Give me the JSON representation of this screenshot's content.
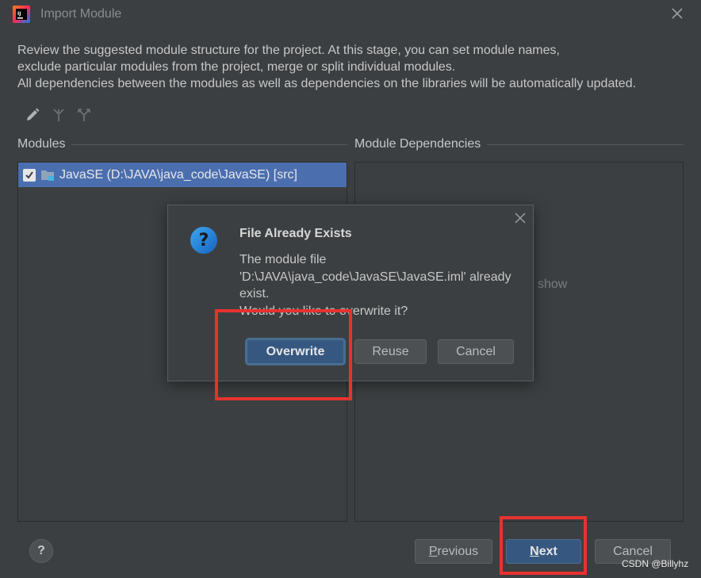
{
  "window": {
    "title": "Import Module",
    "icons": {
      "app": "intellij-idea-icon",
      "close": "close-icon"
    }
  },
  "description": {
    "line1": "Review the suggested module structure for the project. At this stage, you can set module names,",
    "line2": "exclude particular modules from the project, merge or split individual modules.",
    "line3": "All dependencies between the modules as well as dependencies on the libraries will be automatically updated."
  },
  "toolbar": {
    "icons": [
      "edit-icon",
      "merge-icon",
      "split-icon"
    ]
  },
  "modules": {
    "header": "Modules",
    "items": [
      {
        "label": "JavaSE (D:\\JAVA\\java_code\\JavaSE) [src]",
        "checked": true
      }
    ]
  },
  "dependencies": {
    "header": "Module Dependencies",
    "hint": "show"
  },
  "dialog": {
    "title": "File Already Exists",
    "message_line1": "The module file",
    "message_line2": "'D:\\JAVA\\java_code\\JavaSE\\JavaSE.iml' already",
    "message_line3": "exist.",
    "message_line4": "Would you like to overwrite it?",
    "buttons": {
      "overwrite": "Overwrite",
      "reuse": "Reuse",
      "cancel": "Cancel"
    },
    "icon": "question-icon"
  },
  "footer": {
    "help": "?",
    "previous_mnemonic": "P",
    "previous_rest": "revious",
    "next_mnemonic": "N",
    "next_rest": "ext",
    "cancel": "Cancel"
  },
  "watermark": "CSDN @Billyhz",
  "colors": {
    "background": "#3c3f41",
    "selection": "#4b6eaf",
    "primary_button": "#365880",
    "annotation_red": "#e8312f"
  }
}
